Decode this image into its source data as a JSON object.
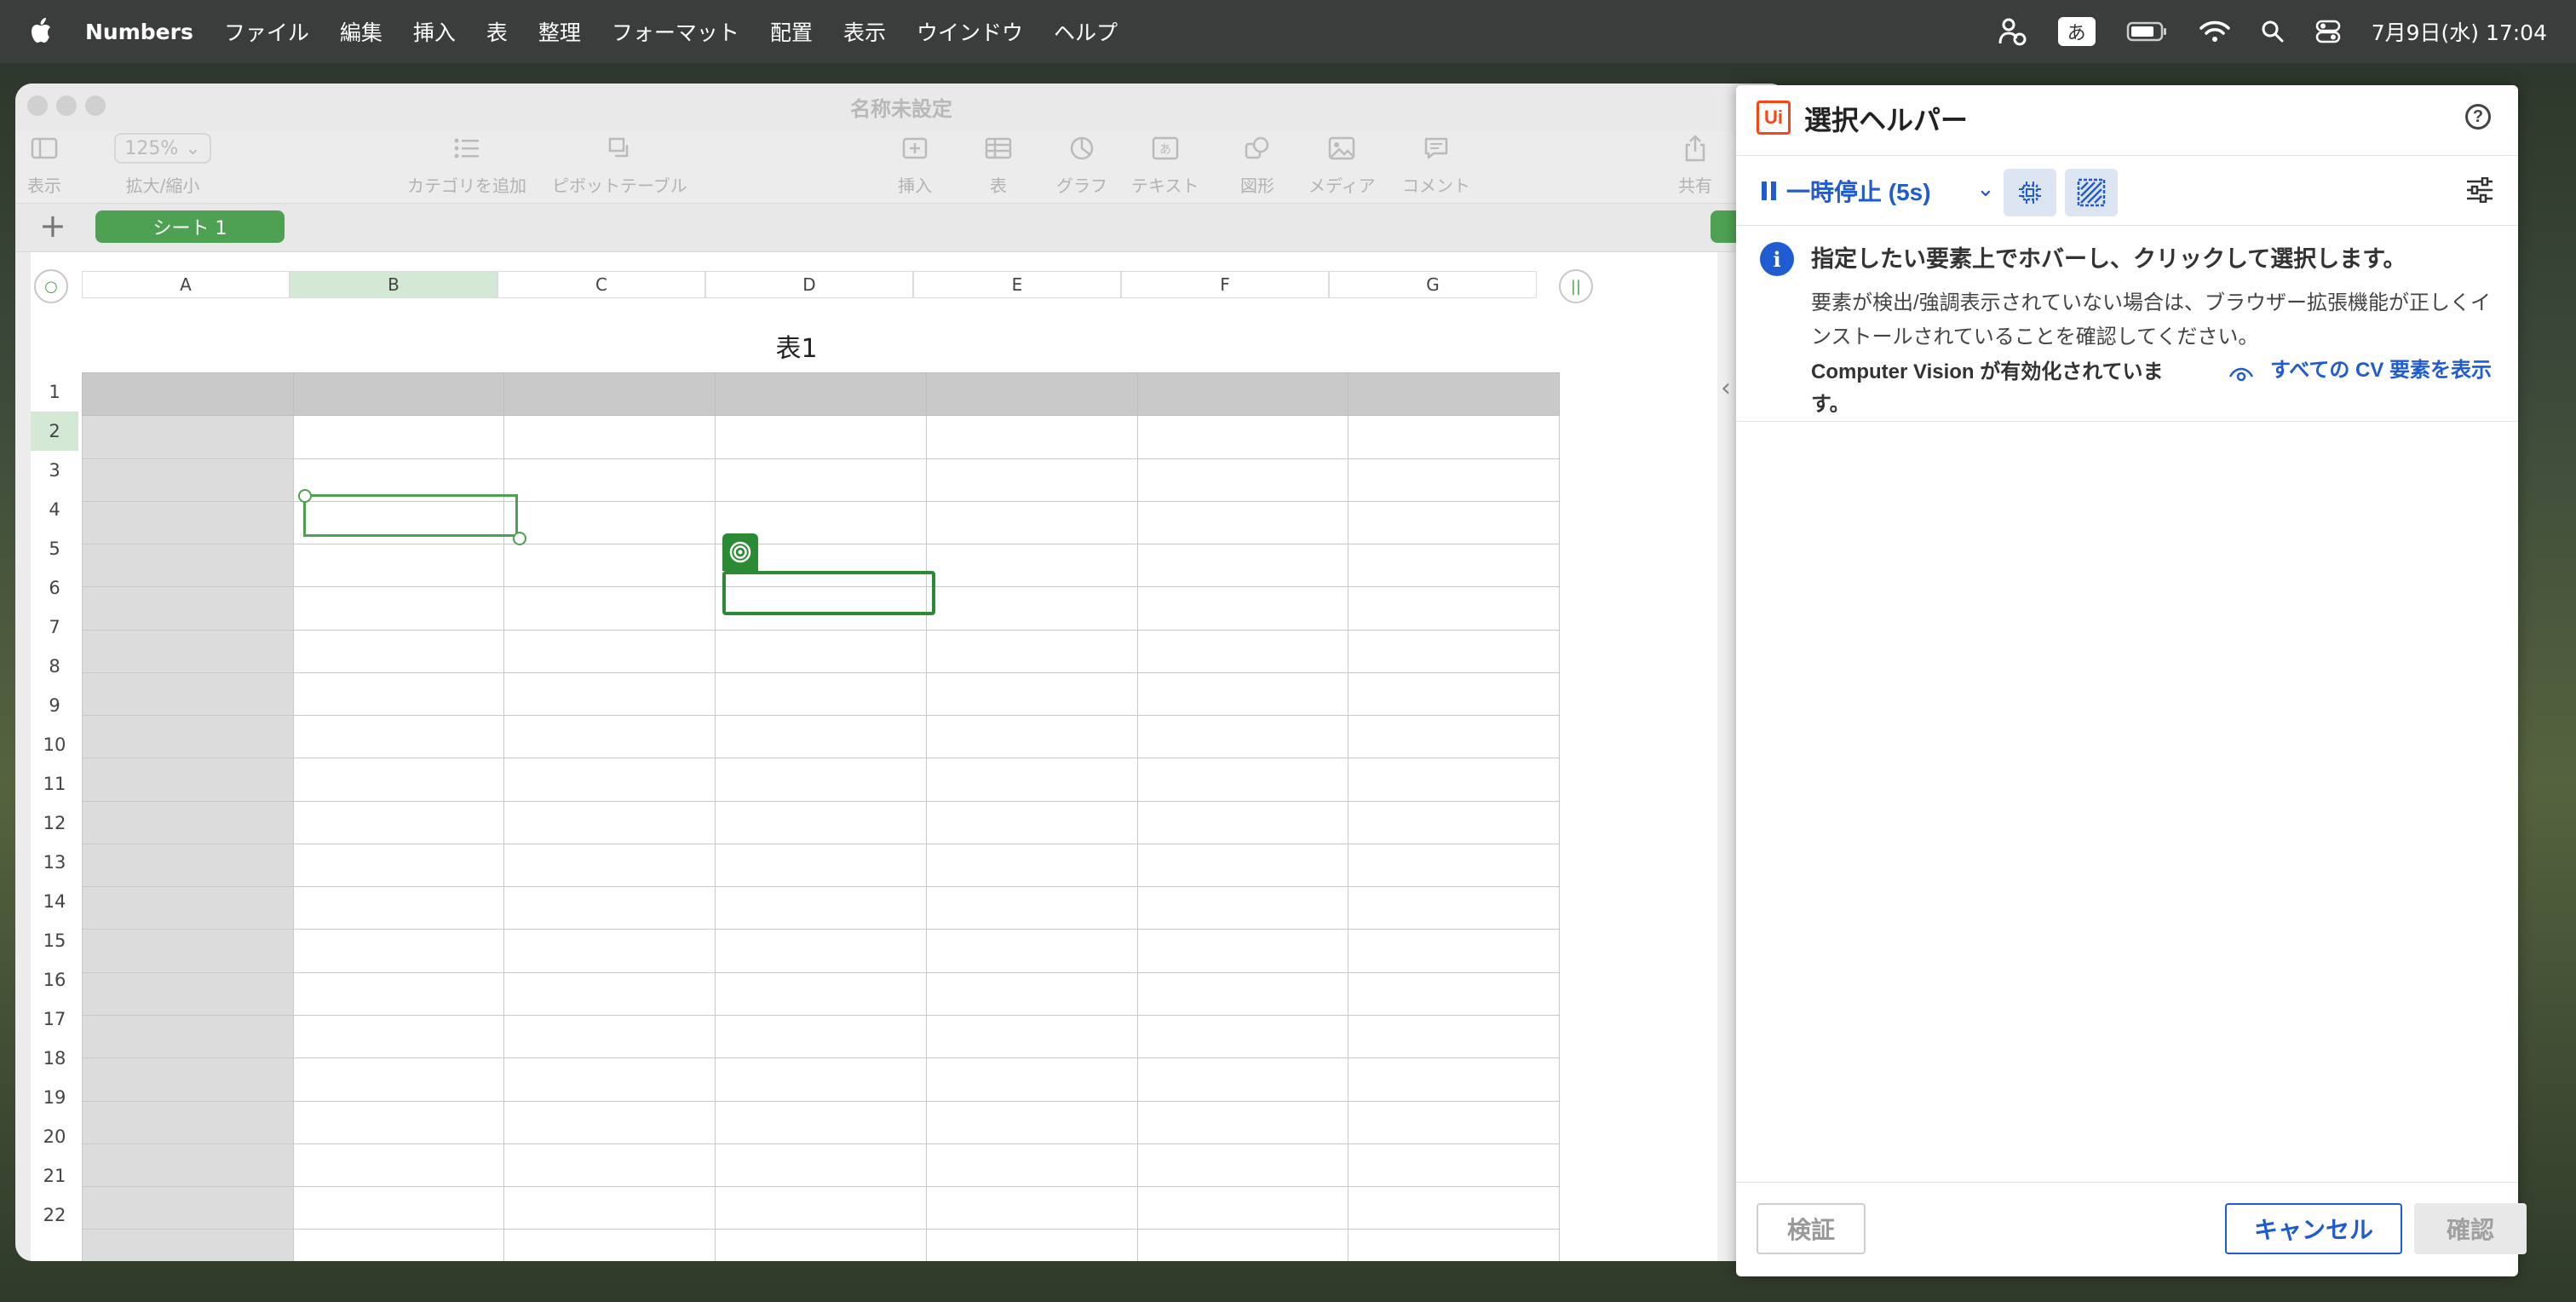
{
  "menubar": {
    "app_name": "Numbers",
    "menus": [
      "ファイル",
      "編集",
      "挿入",
      "表",
      "整理",
      "フォーマット",
      "配置",
      "表示",
      "ウインドウ",
      "ヘルプ"
    ],
    "ime_label": "あ",
    "datetime": "7月9日(水) 17:04"
  },
  "window": {
    "title": "名称未設定",
    "toolbar": {
      "view_label": "表示",
      "zoom_value": "125%",
      "zoom_label": "拡大/縮小",
      "add_category_label": "カテゴリを追加",
      "pivot_label": "ピボットテーブル",
      "insert_label": "挿入",
      "table_label": "表",
      "chart_label": "グラフ",
      "text_label": "テキスト",
      "shape_label": "図形",
      "media_label": "メディア",
      "comment_label": "コメント",
      "share_label": "共有"
    },
    "sheet_tab": "シート 1",
    "table_title": "表1",
    "columns": [
      "A",
      "B",
      "C",
      "D",
      "E",
      "F",
      "G"
    ],
    "rows": [
      "1",
      "2",
      "3",
      "4",
      "5",
      "6",
      "7",
      "8",
      "9",
      "10",
      "11",
      "12",
      "13",
      "14",
      "15",
      "16",
      "17",
      "18",
      "19",
      "20",
      "21",
      "22"
    ],
    "selected_column": "B",
    "selected_row": "2"
  },
  "panel": {
    "logo": "Ui",
    "title": "選択ヘルパー",
    "pause_label": "一時停止 (5s)",
    "info_main": "指定したい要素上でホバーし、クリックして選択します。",
    "info_sub": "要素が検出/強調表示されていない場合は、ブラウザー拡張機能が正しくインストールされていることを確認してください。",
    "cv_note": "Computer Vision が有効化されています。",
    "cv_link": "すべての CV 要素を表示",
    "verify_label": "検証",
    "cancel_label": "キャンセル",
    "confirm_label": "確認",
    "accent_color": "#1f5bd1",
    "brand_color": "#fa4616"
  }
}
